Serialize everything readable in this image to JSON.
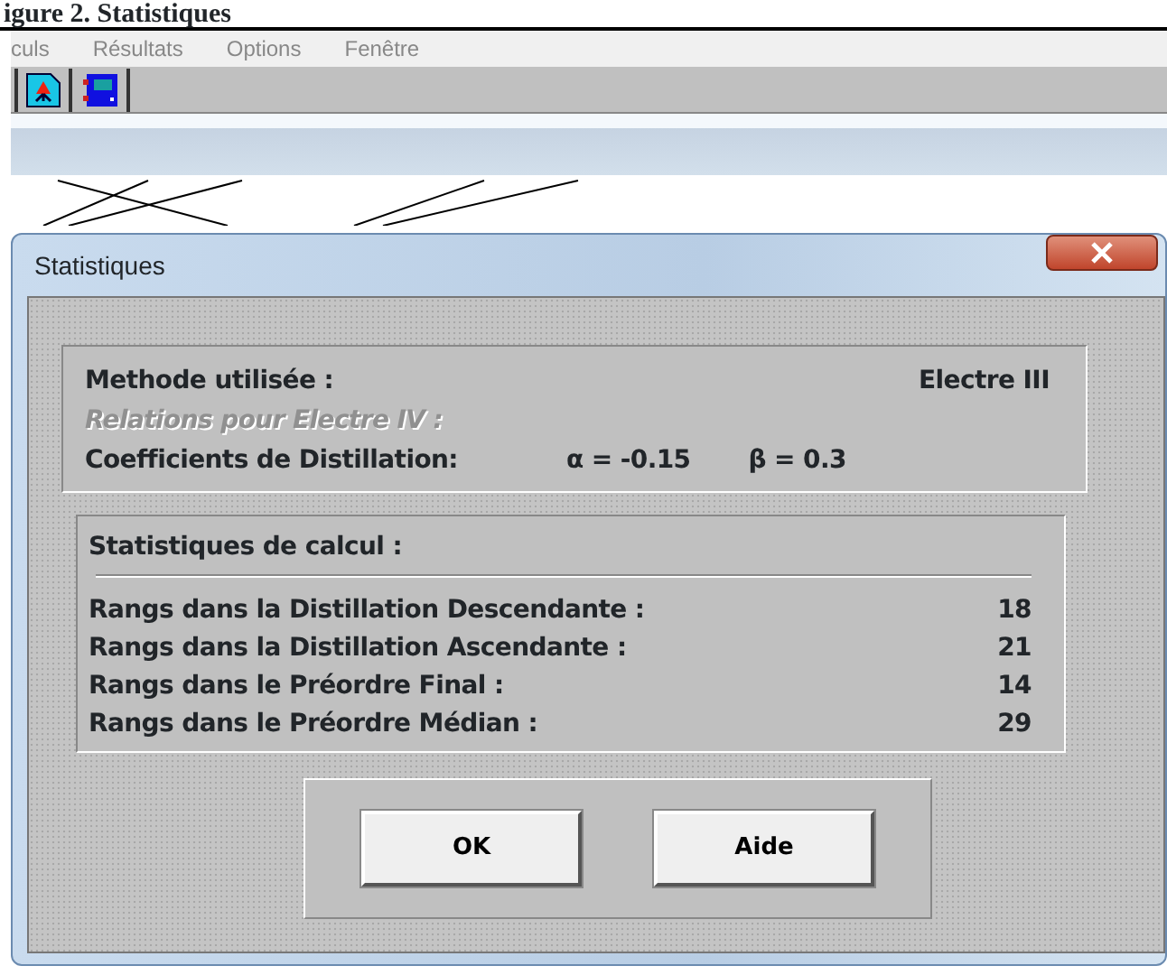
{
  "document_caption": "igure 2. Statistiques",
  "menu": [
    "culs",
    "Résultats",
    "Options",
    "Fenêtre"
  ],
  "dialog": {
    "title": "Statistiques",
    "method": {
      "label": "Methode utilisée :",
      "value": "Electre III"
    },
    "relations": {
      "label": "Relations pour Electre IV :",
      "disabled": true
    },
    "coefficients": {
      "label": "Coefficients de Distillation:",
      "alpha": "α = -0.15",
      "beta": "β = 0.3"
    },
    "stats": {
      "title": "Statistiques de calcul :",
      "rows": [
        {
          "label": "Rangs dans la Distillation Descendante :",
          "value": "18"
        },
        {
          "label": "Rangs dans la Distillation Ascendante :",
          "value": "21"
        },
        {
          "label": "Rangs dans le Préordre Final :",
          "value": "14"
        },
        {
          "label": "Rangs dans le Préordre Médian :",
          "value": "29"
        }
      ]
    },
    "buttons": [
      "OK",
      "Aide"
    ]
  }
}
